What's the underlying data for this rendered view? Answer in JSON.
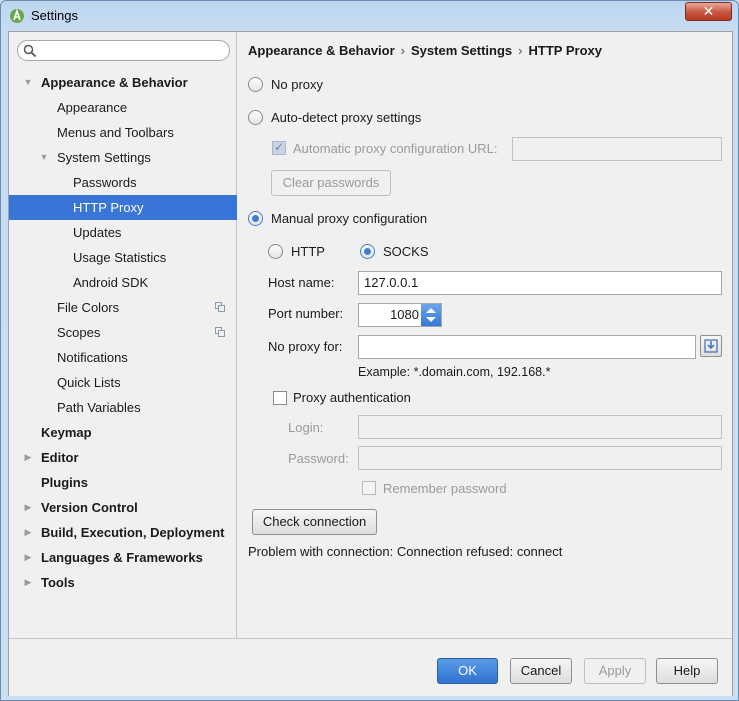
{
  "window": {
    "title": "Settings",
    "close_label": "✕"
  },
  "search": {
    "placeholder": ""
  },
  "tree": [
    {
      "label": "Appearance & Behavior",
      "bold": true,
      "arrow": "▼",
      "level": 0
    },
    {
      "label": "Appearance",
      "level": 1
    },
    {
      "label": "Menus and Toolbars",
      "level": 1
    },
    {
      "label": "System Settings",
      "arrow": "▼",
      "level": 1
    },
    {
      "label": "Passwords",
      "level": 2
    },
    {
      "label": "HTTP Proxy",
      "level": 2,
      "selected": true
    },
    {
      "label": "Updates",
      "level": 2
    },
    {
      "label": "Usage Statistics",
      "level": 2
    },
    {
      "label": "Android SDK",
      "level": 2
    },
    {
      "label": "File Colors",
      "level": 1,
      "copy": true
    },
    {
      "label": "Scopes",
      "level": 1,
      "copy": true
    },
    {
      "label": "Notifications",
      "level": 1
    },
    {
      "label": "Quick Lists",
      "level": 1
    },
    {
      "label": "Path Variables",
      "level": 1
    },
    {
      "label": "Keymap",
      "bold": true,
      "level": 0
    },
    {
      "label": "Editor",
      "bold": true,
      "arrow": "▶",
      "level": 0
    },
    {
      "label": "Plugins",
      "bold": true,
      "level": 0
    },
    {
      "label": "Version Control",
      "bold": true,
      "arrow": "▶",
      "level": 0
    },
    {
      "label": "Build, Execution, Deployment",
      "bold": true,
      "arrow": "▶",
      "level": 0
    },
    {
      "label": "Languages & Frameworks",
      "bold": true,
      "arrow": "▶",
      "level": 0
    },
    {
      "label": "Tools",
      "bold": true,
      "arrow": "▶",
      "level": 0
    }
  ],
  "breadcrumb": {
    "part1": "Appearance & Behavior",
    "sep": "›",
    "part2": "System Settings",
    "part3": "HTTP Proxy"
  },
  "proxy": {
    "no_proxy": "No proxy",
    "auto_detect": "Auto-detect proxy settings",
    "auto_config_url": "Automatic proxy configuration URL:",
    "clear_passwords": "Clear passwords",
    "manual": "Manual proxy configuration",
    "http": "HTTP",
    "socks": "SOCKS",
    "host_label": "Host name:",
    "host_value": "127.0.0.1",
    "port_label": "Port number:",
    "port_value": "1080",
    "no_proxy_for_label": "No proxy for:",
    "no_proxy_for_value": "",
    "example": "Example: *.domain.com, 192.168.*",
    "auth": "Proxy authentication",
    "login_label": "Login:",
    "password_label": "Password:",
    "remember": "Remember password",
    "check_connection": "Check connection",
    "problem": "Problem with connection: Connection refused: connect"
  },
  "buttons": {
    "ok": "OK",
    "cancel": "Cancel",
    "apply": "Apply",
    "help": "Help"
  },
  "colors": {
    "selection": "#3875d7",
    "primary_button": "#3d7fd4"
  }
}
